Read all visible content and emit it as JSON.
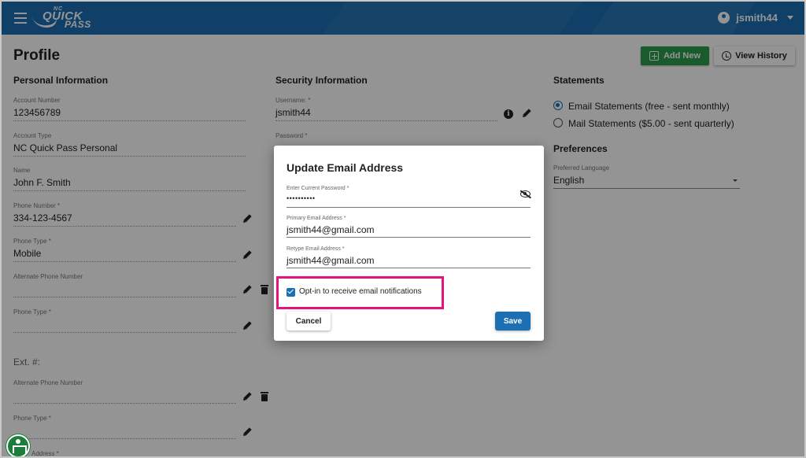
{
  "header": {
    "logo_nc": "NC",
    "logo_quick": "QUICK",
    "logo_pass": "PASS",
    "username": "jsmith44"
  },
  "page": {
    "title": "Profile",
    "add_new_label": "Add New",
    "view_history_label": "View History"
  },
  "personal": {
    "heading": "Personal Information",
    "account_number_label": "Account Number",
    "account_number": "123456789",
    "account_type_label": "Account Type",
    "account_type": "NC Quick Pass Personal",
    "name_label": "Name",
    "name": "John F. Smith",
    "phone_label": "Phone Number *",
    "phone": "334-123-4567",
    "phone_type_label": "Phone Type *",
    "phone_type": "Mobile",
    "alt_phone_label": "Alternate Phone Number",
    "phone_type2_label": "Phone Type *",
    "ext_label": "Ext. #:",
    "alt_phone2_label": "Alternate Phone Number",
    "phone_type3_label": "Phone Type *",
    "address_label": "Address *"
  },
  "security": {
    "heading": "Security Information",
    "username_label": "Username: *",
    "username": "jsmith44",
    "password_label": "Password *"
  },
  "statements": {
    "heading": "Statements",
    "option_email": "Email Statements (free - sent monthly)",
    "option_mail": "Mail Statements ($5.00 - sent quarterly)",
    "selected": "email"
  },
  "preferences": {
    "heading": "Preferences",
    "language_label": "Preferred Language",
    "language": "English"
  },
  "dialog": {
    "title": "Update Email Address",
    "password_label": "Enter Current Password *",
    "password_value": "••••••••••",
    "primary_email_label": "Primary Email Address *",
    "primary_email": "jsmith44@gmail.com",
    "retype_email_label": "Retype Email Address *",
    "retype_email": "jsmith44@gmail.com",
    "optin_label": "Opt-in to receive email notifications",
    "optin_checked": true,
    "cancel_label": "Cancel",
    "save_label": "Save"
  },
  "colors": {
    "brand_blue": "#1c6fb3",
    "add_green": "#2e9e4f",
    "highlight_pink": "#e5147d"
  }
}
